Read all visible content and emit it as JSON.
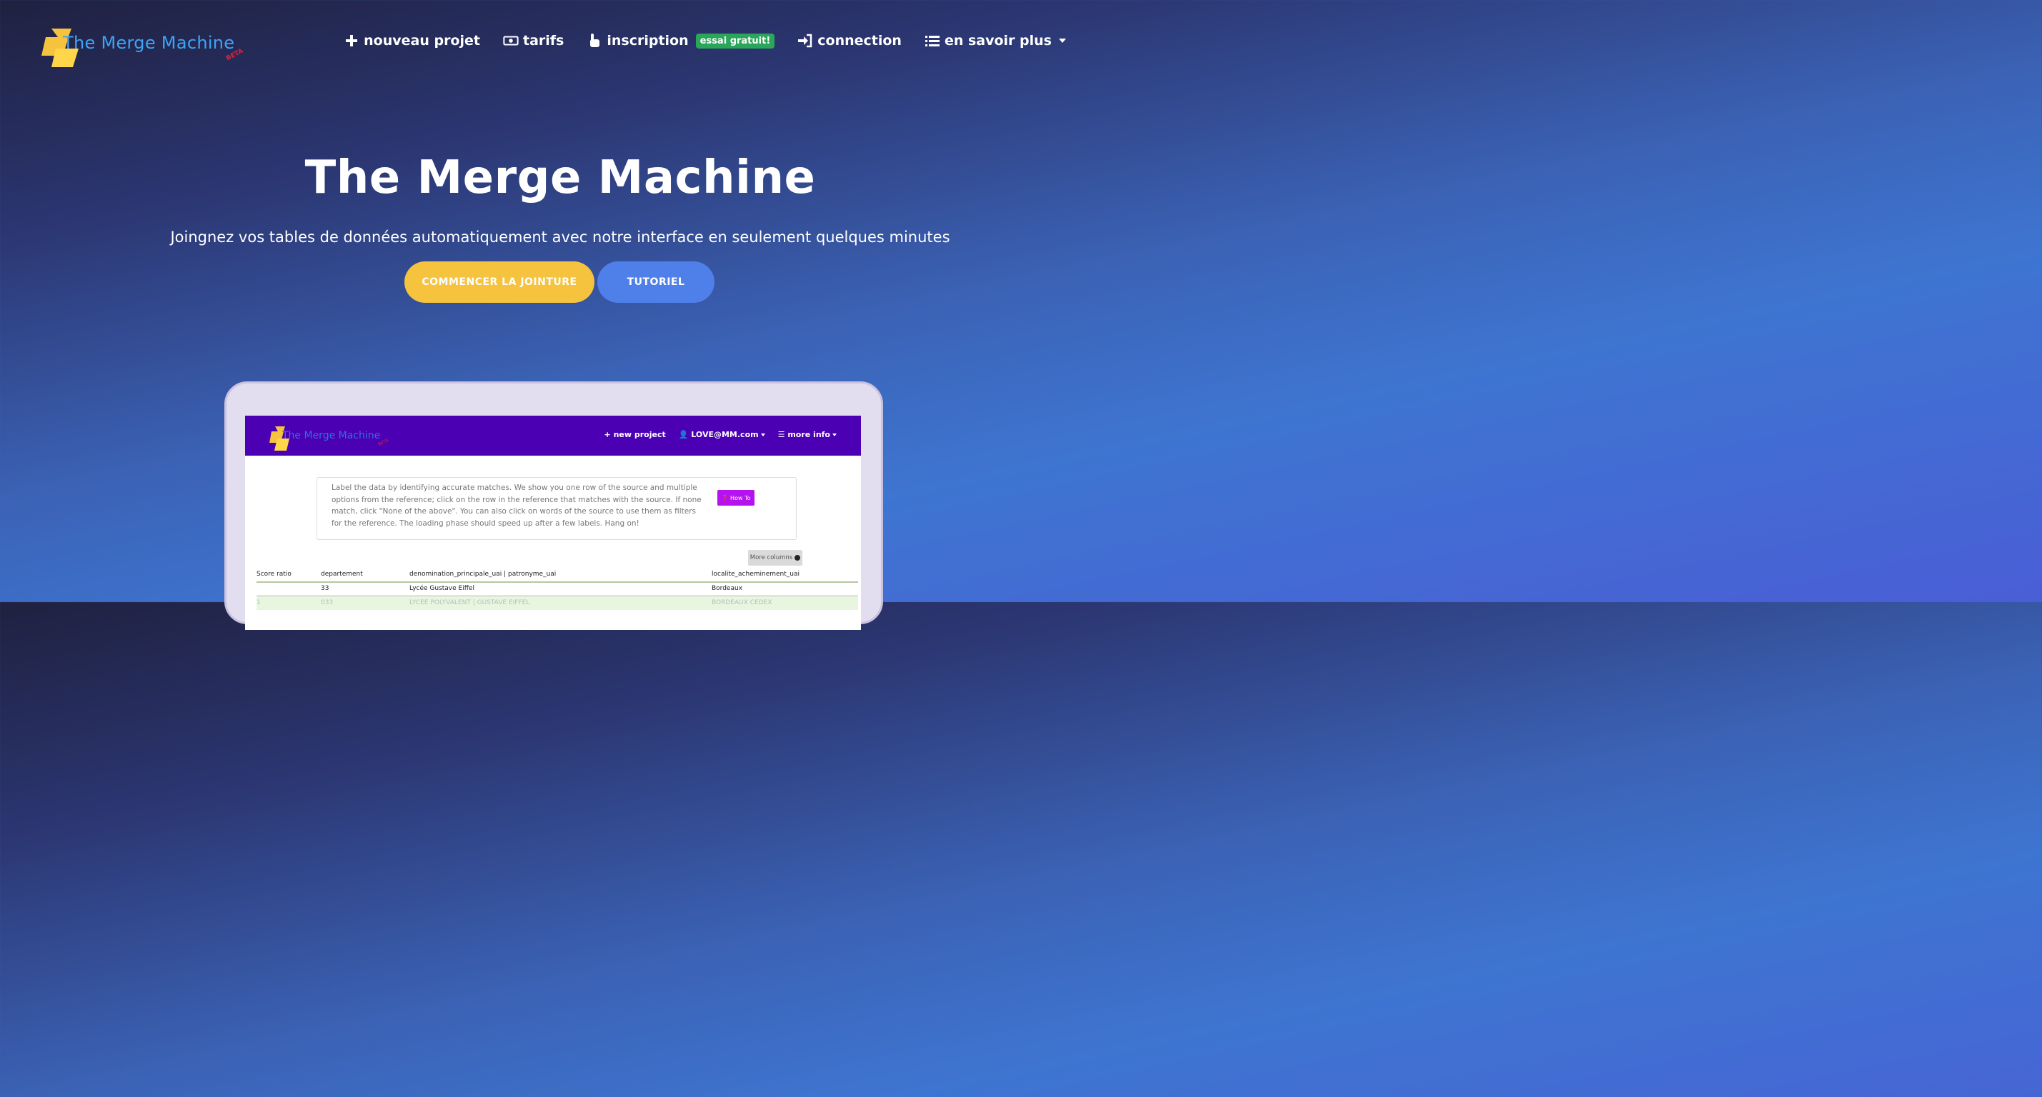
{
  "brand": {
    "name": "The Merge Machine",
    "beta": "BETA",
    "logo_icon": "lightning-logo-icon"
  },
  "nav": {
    "new_project": "nouveau projet",
    "pricing": "tarifs",
    "signup": "inscription",
    "signup_badge": "essai gratuit!",
    "login": "connection",
    "more": "en savoir plus"
  },
  "hero": {
    "title": "The Merge Machine",
    "subtitle": "Joingnez vos tables de données automatiquement avec notre interface en seulement quelques minutes",
    "cta_primary": "COMMENCER LA JOINTURE",
    "cta_secondary": "TUTORIEL"
  },
  "colors": {
    "primary_btn": "#f6c33f",
    "secondary_btn": "#4f7fe9",
    "badge": "#2aa65a",
    "mock_nav": "#4b00b3"
  },
  "mockup": {
    "brand": "The Merge Machine",
    "beta": "BETA",
    "nav": {
      "new_project": "new project",
      "user": "LOVE@MM.com",
      "more": "more info"
    },
    "info_text": "Label the data by identifying accurate matches. We show you one row of the source and multiple options from the reference; click on the row in the reference that matches with the source. If none match, click \"None of the above\". You can also click on words of the source to use them as filters for the reference. The loading phase should speed up after a few labels. Hang on!",
    "how_to": "How To",
    "more_columns": "More columns",
    "table": {
      "headers": [
        "Score ratio",
        "departement",
        "denomination_principale_uai | patronyme_uai",
        "localite_acheminement_uai"
      ],
      "rows": [
        [
          "",
          "33",
          "Lycée Gustave Eiffel",
          "Bordeaux"
        ],
        [
          "1",
          "033",
          "LYCEE POLYVALENT | GUSTAVE EIFFEL",
          "BORDEAUX CEDEX"
        ]
      ]
    }
  }
}
